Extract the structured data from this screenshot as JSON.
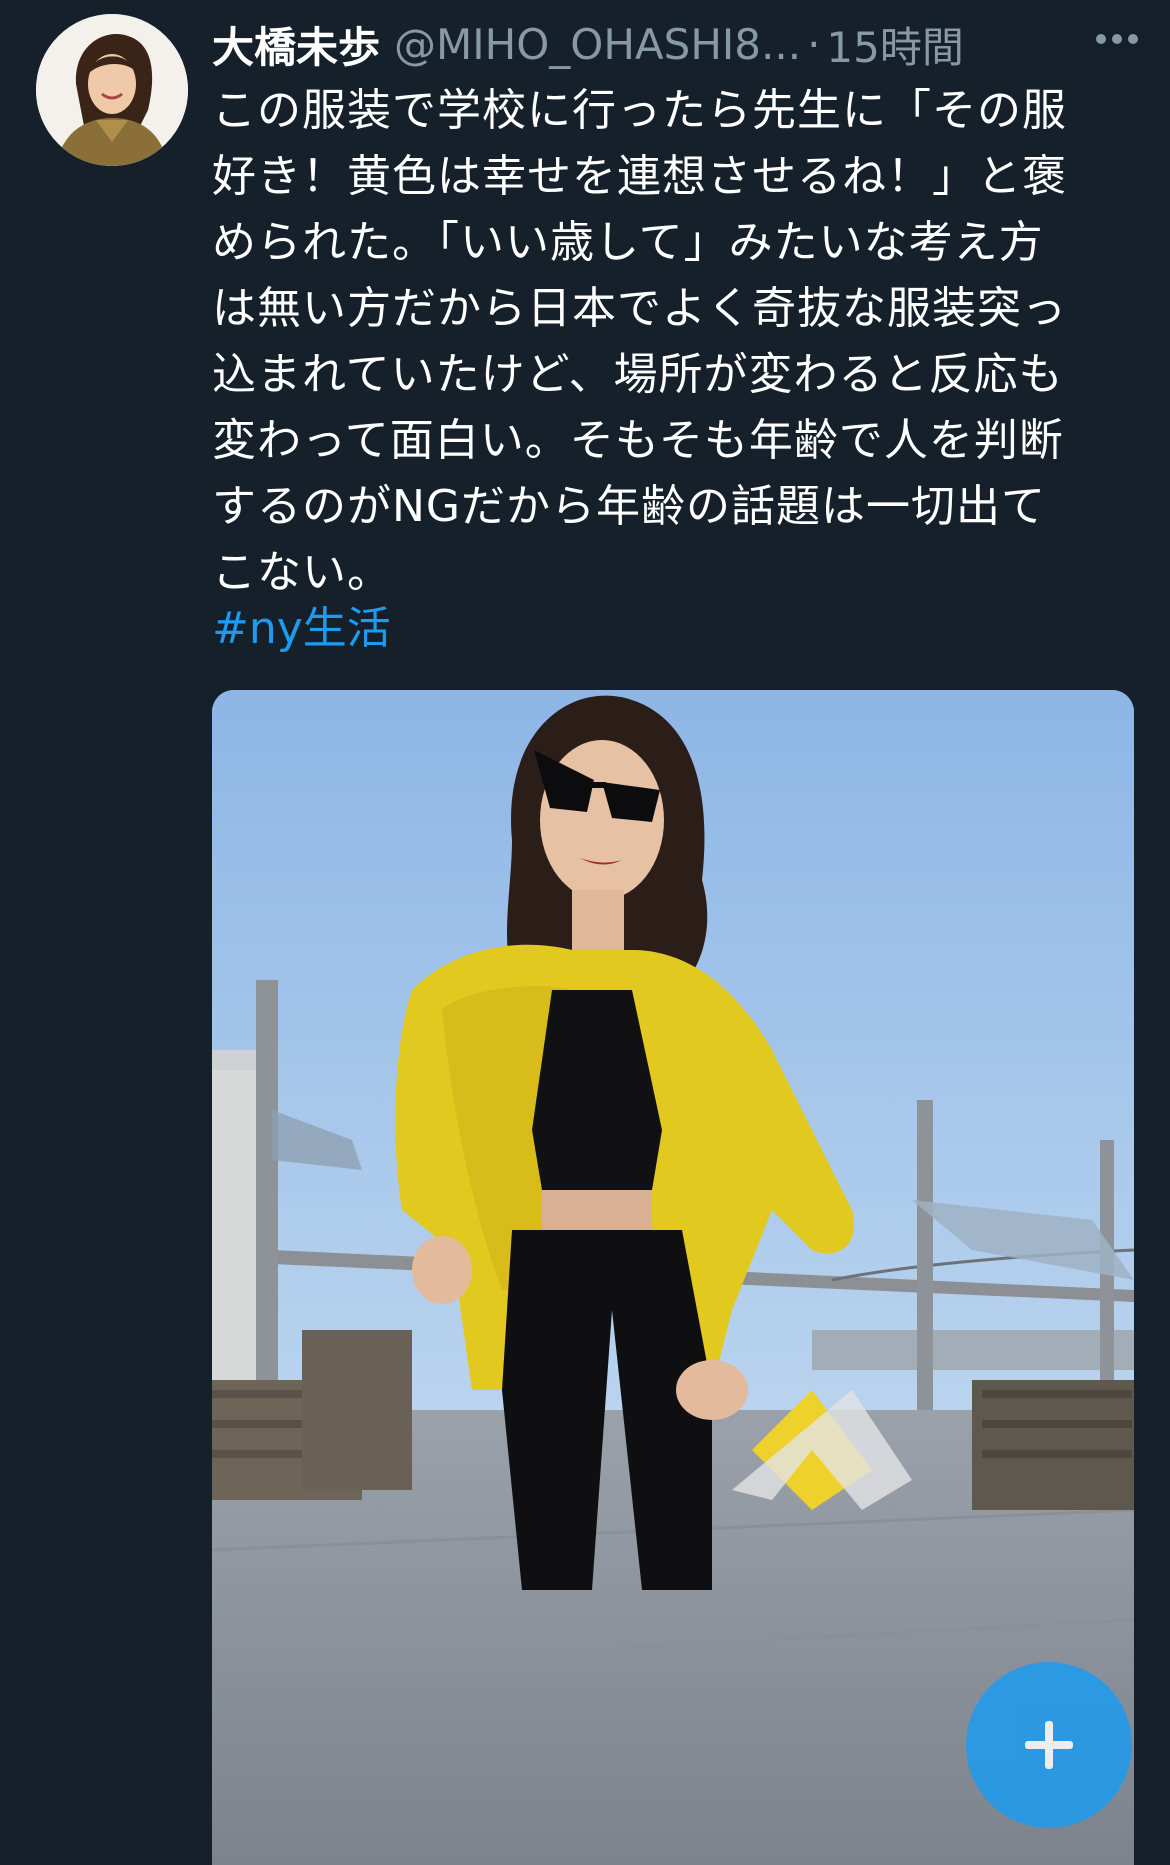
{
  "tweet": {
    "author_name": "大橋未歩",
    "handle": "@MIHO_OHASHI8...",
    "separator": "·",
    "time": "15時間",
    "more_icon": "more-horizontal-icon",
    "text_lines": [
      "この服装で学校に行ったら先生に「その服",
      "好き！黄色は幸せを連想させるね！」と褒",
      "められた。「いい歳して」みたいな考え方",
      "は無い方だから日本でよく奇抜な服装突っ",
      "込まれていたけど、場所が変わると反応も",
      "変わって面白い。そもそも年齢で人を判断",
      "するのがNGだから年齢の話題は一切出て",
      "こない。"
    ],
    "hashtag": "#ny生活"
  },
  "colors": {
    "background": "#15202b",
    "text": "#ffffff",
    "secondary_text": "#8899a6",
    "link": "#1d9bf0",
    "fab": "#1d9bf0"
  },
  "fab": {
    "icon": "plus-icon"
  }
}
